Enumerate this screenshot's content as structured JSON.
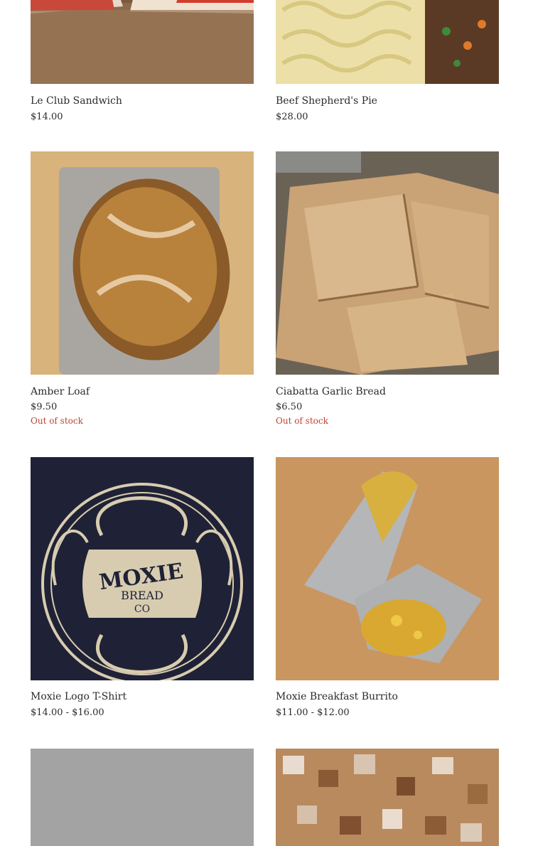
{
  "products": [
    {
      "name": "Le Club Sandwich",
      "price": "$14.00",
      "stock": "",
      "image": "club-sandwich-photo"
    },
    {
      "name": "Beef Shepherd's Pie",
      "price": "$28.00",
      "stock": "",
      "image": "shepherds-pie-photo"
    },
    {
      "name": "Amber Loaf",
      "price": "$9.50",
      "stock": "Out of stock",
      "image": "amber-loaf-photo"
    },
    {
      "name": "Ciabatta Garlic Bread",
      "price": "$6.50",
      "stock": "Out of stock",
      "image": "garlic-bread-photo"
    },
    {
      "name": "Moxie Logo T-Shirt",
      "price": "$14.00 - $16.00",
      "stock": "",
      "image": "logo-tshirt-photo"
    },
    {
      "name": "Moxie Breakfast Burrito",
      "price": "$11.00 - $12.00",
      "stock": "",
      "image": "breakfast-burrito-photo"
    },
    {
      "name": "",
      "price": "",
      "stock": "",
      "image": "placeholder-image"
    },
    {
      "name": "",
      "price": "",
      "stock": "",
      "image": "croutons-photo"
    }
  ],
  "tshirt_logo": {
    "line1": "MOXIE",
    "line2": "BREAD",
    "line3": "CO"
  },
  "colors": {
    "out_of_stock": "#c2402e",
    "text": "#2b2b2b"
  }
}
